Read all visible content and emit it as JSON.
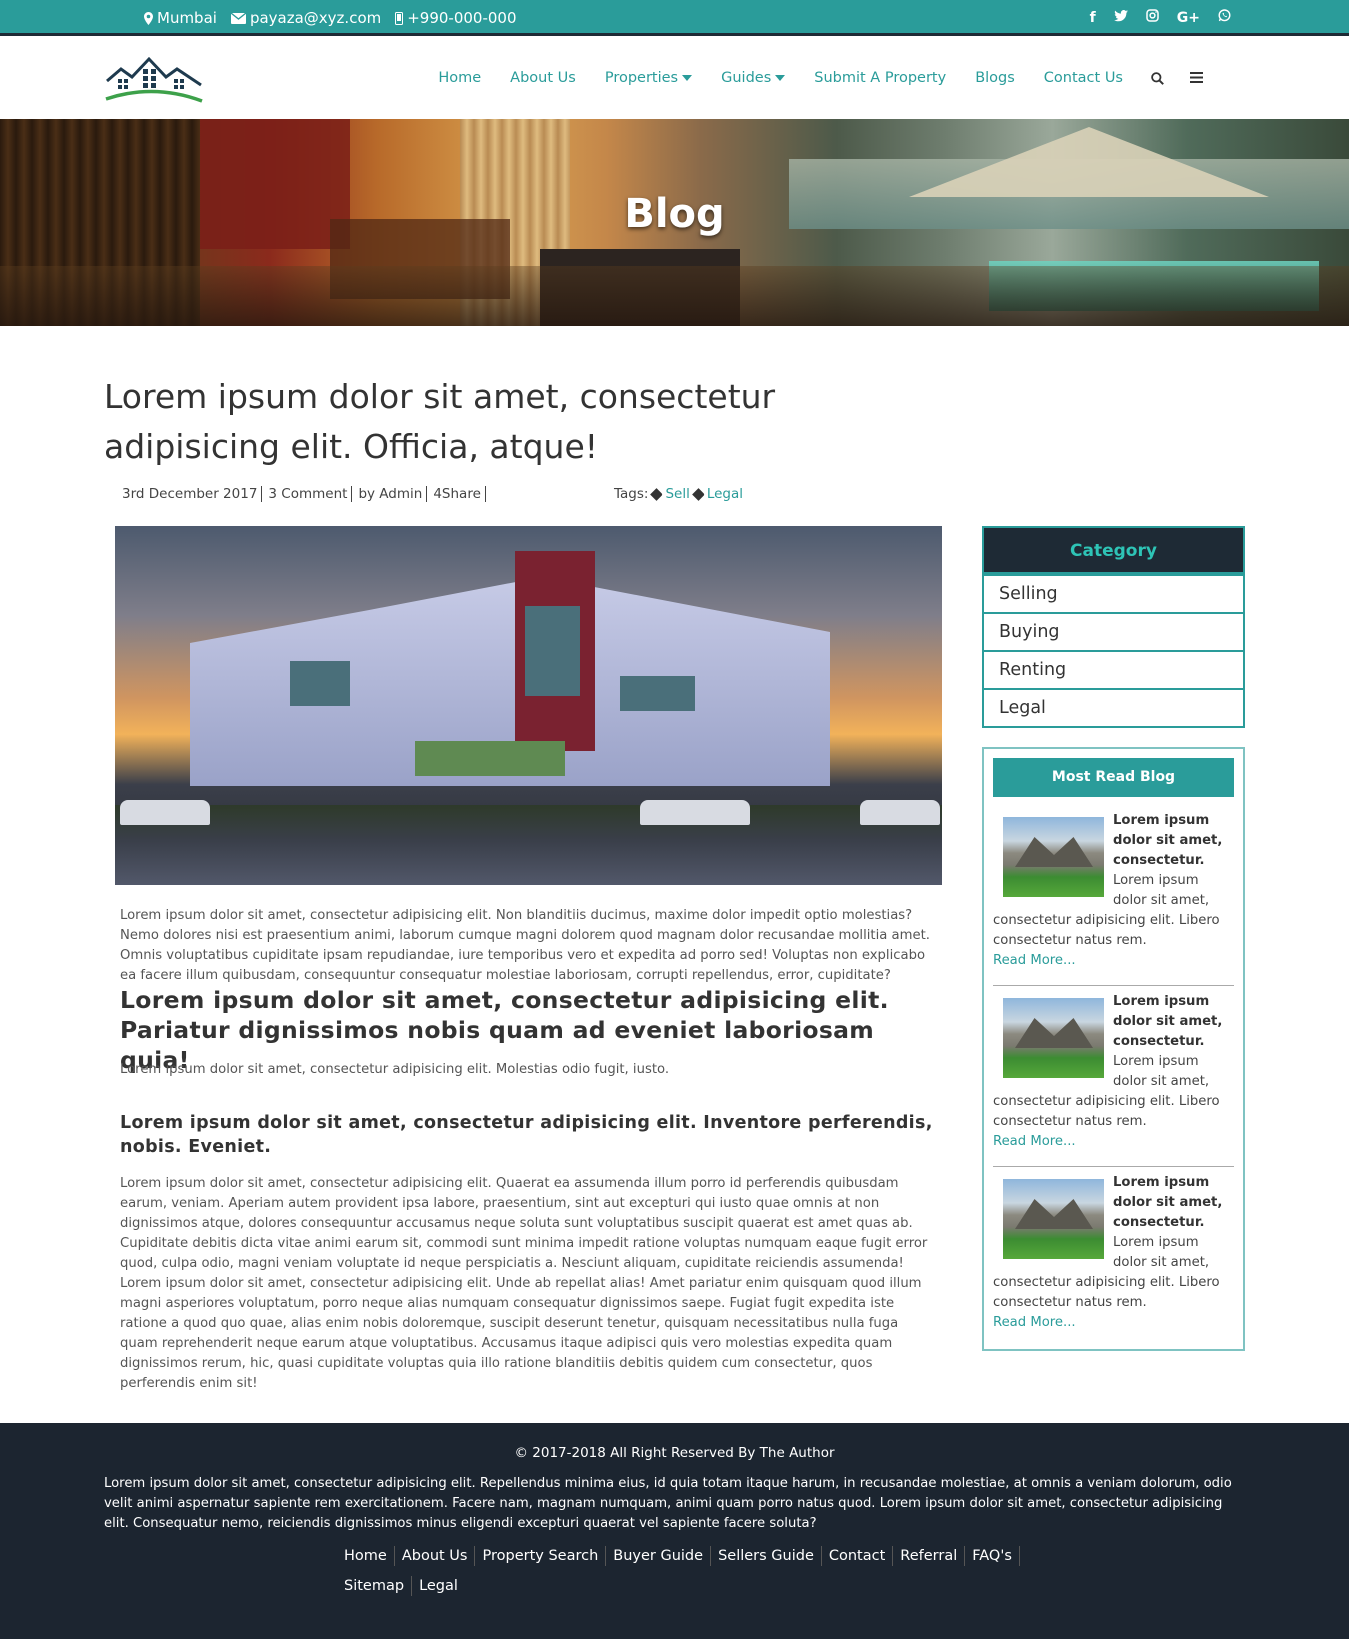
{
  "topbar": {
    "city": "Mumbai",
    "email": "payaza@xyz.com",
    "phone": "+990-000-000",
    "social_icons": [
      "facebook-icon",
      "twitter-icon",
      "instagram-icon",
      "google-plus-icon",
      "whatsapp-icon"
    ],
    "social_labels": [
      "f",
      "🐦",
      "◎",
      "G+",
      "◯"
    ],
    "color": "#2a9c9a"
  },
  "nav": {
    "items": [
      "Home",
      "About Us",
      "Properties",
      "Guides",
      "Submit A Property",
      "Blogs",
      "Contact Us"
    ],
    "dropdowns": [
      "Properties",
      "Guides"
    ],
    "search_icon": "search-icon",
    "menu_icon": "hamburger-icon"
  },
  "banner": {
    "title": "Blog"
  },
  "post": {
    "title": "Lorem ipsum dolor sit amet, consectetur adipisicing elit. Officia, atque!",
    "date": "3rd December 2017",
    "comments": "3 Comment",
    "author": "by Admin",
    "share": "4Share",
    "tags_label": "Tags:",
    "tags": [
      "Sell",
      "Legal"
    ],
    "para1": "Lorem ipsum dolor sit amet, consectetur adipisicing elit. Non blanditiis ducimus, maxime dolor impedit optio molestias? Nemo dolores nisi est praesentium animi, laborum cumque magni dolorem quod magnam dolor recusandae mollitia amet. Omnis voluptatibus cupiditate ipsam repudiandae, iure temporibus vero et expedita ad porro sed! Voluptas non explicabo ea facere illum quibusdam, consequuntur consequatur molestiae laboriosam, corrupti repellendus, error, cupiditate?",
    "heading1": "Lorem ipsum dolor sit amet, consectetur adipisicing elit. Pariatur dignissimos nobis quam ad eveniet laboriosam quia!",
    "para2": "Lorem ipsum dolor sit amet, consectetur adipisicing elit. Molestias odio fugit, iusto.",
    "heading2": "Lorem ipsum dolor sit amet, consectetur adipisicing elit. Inventore perferendis, nobis. Eveniet.",
    "para3": "Lorem ipsum dolor sit amet, consectetur adipisicing elit. Quaerat ea assumenda illum porro id perferendis quibusdam earum, veniam. Aperiam autem provident ipsa labore, praesentium, sint aut excepturi qui iusto quae omnis at non dignissimos atque, dolores consequuntur accusamus neque soluta sunt voluptatibus suscipit quaerat est amet quas ab. Cupiditate debitis dicta vitae animi earum sit, commodi sunt minima impedit ratione voluptas numquam eaque fugit error quod, culpa odio, magni veniam voluptate id neque perspiciatis a. Nesciunt aliquam, cupiditate reiciendis assumenda! Lorem ipsum dolor sit amet, consectetur adipisicing elit. Unde ab repellat alias! Amet pariatur enim quisquam quod illum magni asperiores voluptatum, porro neque alias numquam consequatur dignissimos saepe. Fugiat fugit expedita iste ratione a quod quo quae, alias enim nobis doloremque, suscipit deserunt tenetur, quisquam necessitatibus nulla fuga quam reprehenderit neque earum atque voluptatibus. Accusamus itaque adipisci quis vero molestias expedita quam dignissimos rerum, hic, quasi cupiditate voluptas quia illo ratione blanditiis debitis quidem cum consectetur, quos perferendis enim sit!"
  },
  "sidebar": {
    "category_title": "Category",
    "categories": [
      "Selling",
      "Buying",
      "Renting",
      "Legal"
    ],
    "most_read_title": "Most Read Blog",
    "most_read": [
      {
        "title": "Lorem ipsum dolor sit amet, consectetur.",
        "excerpt": "Lorem ipsum dolor sit amet, consectetur adipisicing elit. Libero consectetur natus rem.",
        "more": "Read More..."
      },
      {
        "title": "Lorem ipsum dolor sit amet, consectetur.",
        "excerpt": "Lorem ipsum dolor sit amet, consectetur adipisicing elit. Libero consectetur natus rem.",
        "more": "Read More..."
      },
      {
        "title": "Lorem ipsum dolor sit amet, consectetur.",
        "excerpt": "Lorem ipsum dolor sit amet, consectetur adipisicing elit. Libero consectetur natus rem.",
        "more": "Read More..."
      }
    ]
  },
  "footer": {
    "copyright": "© 2017-2018 All Right Reserved By The Author",
    "paragraph": "Lorem ipsum dolor sit amet, consectetur adipisicing elit. Repellendus minima eius, id quia totam itaque harum, in recusandae molestiae, at omnis a veniam dolorum, odio velit animi aspernatur sapiente rem exercitationem. Facere nam, magnam numquam, animi quam porro natus quod. Lorem ipsum dolor sit amet, consectetur adipisicing elit. Consequatur nemo, reiciendis dignissimos minus eligendi excepturi quaerat vel sapiente facere soluta?",
    "links": [
      "Home",
      "About Us",
      "Property Search",
      "Buyer Guide",
      "Sellers Guide",
      "Contact",
      "Referral",
      "FAQ's",
      "Sitemap",
      "Legal"
    ],
    "bg": "#1c2530"
  }
}
